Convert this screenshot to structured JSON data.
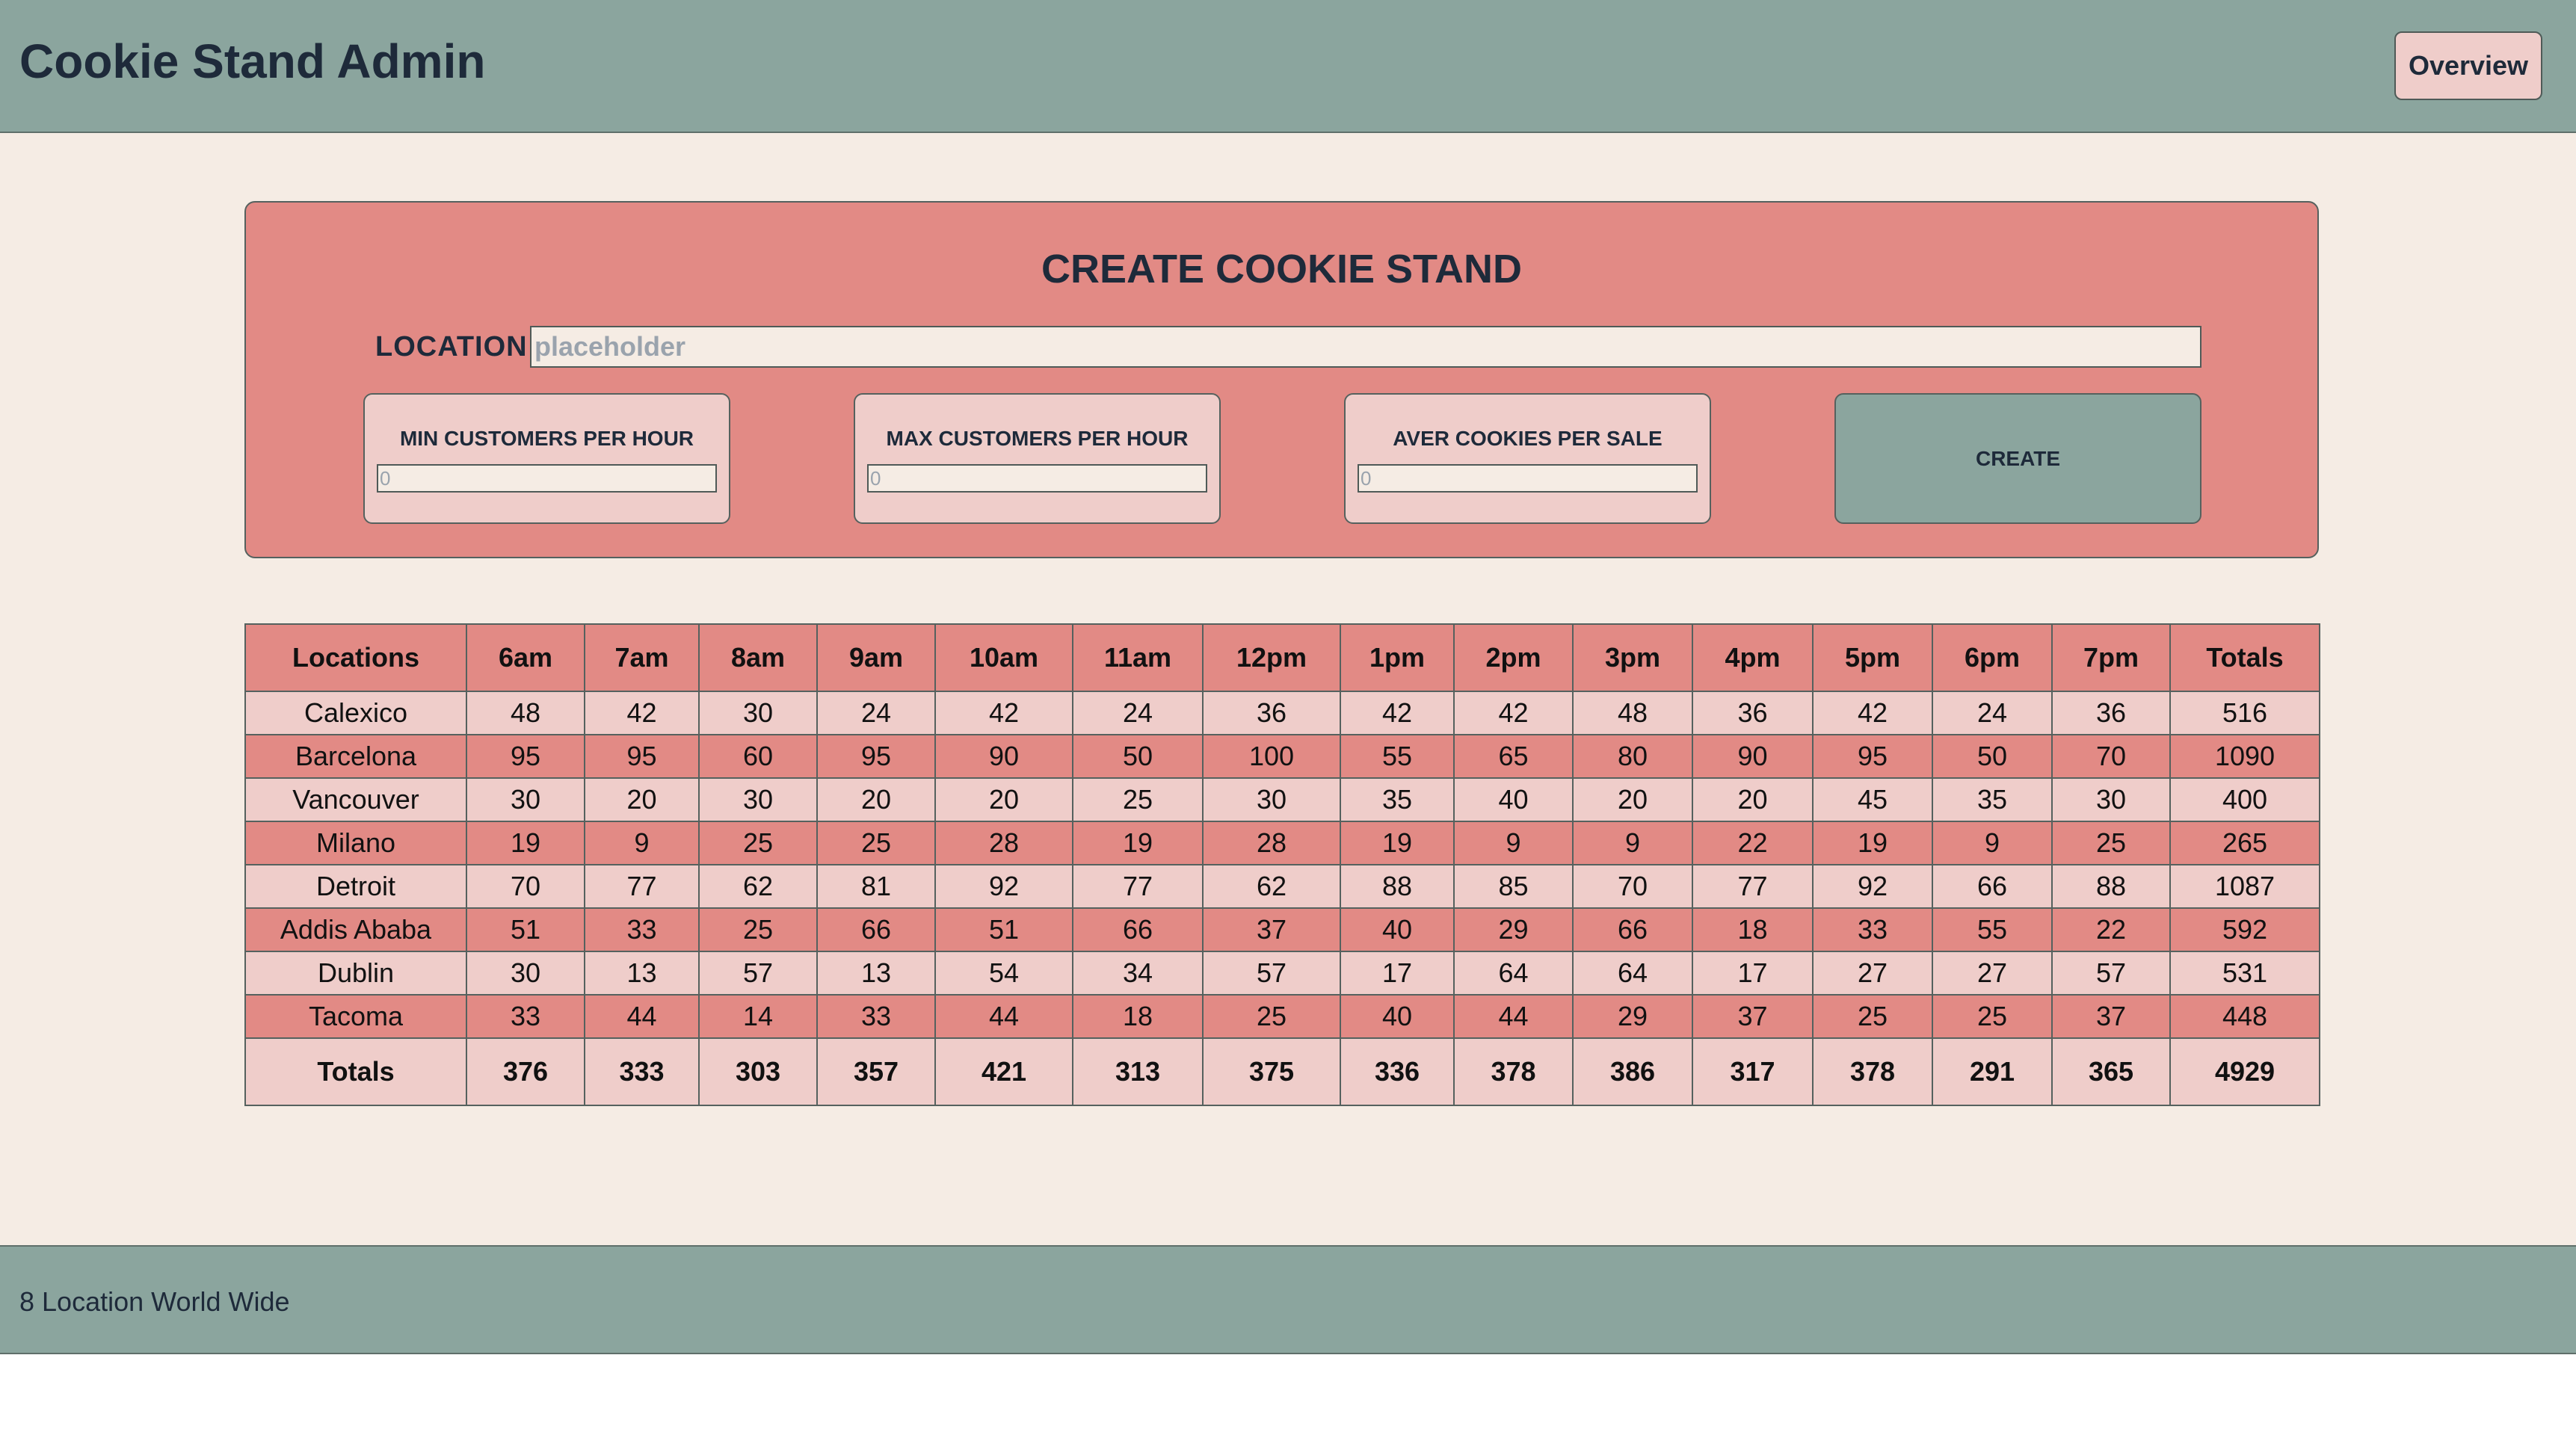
{
  "header": {
    "title": "Cookie Stand Admin",
    "overview_label": "Overview"
  },
  "form": {
    "title": "CREATE COOKIE STAND",
    "location_label": "LOCATION",
    "location_placeholder": "placeholder",
    "min_label": "MIN CUSTOMERS PER HOUR",
    "min_placeholder": "0",
    "max_label": "MAX CUSTOMERS PER HOUR",
    "max_placeholder": "0",
    "avg_label": "AVER COOKIES PER SALE",
    "avg_placeholder": "0",
    "create_label": "CREATE"
  },
  "table": {
    "headers": [
      "Locations",
      "6am",
      "7am",
      "8am",
      "9am",
      "10am",
      "11am",
      "12pm",
      "1pm",
      "2pm",
      "3pm",
      "4pm",
      "5pm",
      "6pm",
      "7pm",
      "Totals"
    ],
    "rows": [
      [
        "Calexico",
        "48",
        "42",
        "30",
        "24",
        "42",
        "24",
        "36",
        "42",
        "42",
        "48",
        "36",
        "42",
        "24",
        "36",
        "516"
      ],
      [
        "Barcelona",
        "95",
        "95",
        "60",
        "95",
        "90",
        "50",
        "100",
        "55",
        "65",
        "80",
        "90",
        "95",
        "50",
        "70",
        "1090"
      ],
      [
        "Vancouver",
        "30",
        "20",
        "30",
        "20",
        "20",
        "25",
        "30",
        "35",
        "40",
        "20",
        "20",
        "45",
        "35",
        "30",
        "400"
      ],
      [
        "Milano",
        "19",
        "9",
        "25",
        "25",
        "28",
        "19",
        "28",
        "19",
        "9",
        "9",
        "22",
        "19",
        "9",
        "25",
        "265"
      ],
      [
        "Detroit",
        "70",
        "77",
        "62",
        "81",
        "92",
        "77",
        "62",
        "88",
        "85",
        "70",
        "77",
        "92",
        "66",
        "88",
        "1087"
      ],
      [
        "Addis Ababa",
        "51",
        "33",
        "25",
        "66",
        "51",
        "66",
        "37",
        "40",
        "29",
        "66",
        "18",
        "33",
        "55",
        "22",
        "592"
      ],
      [
        "Dublin",
        "30",
        "13",
        "57",
        "13",
        "54",
        "34",
        "57",
        "17",
        "64",
        "64",
        "17",
        "27",
        "27",
        "57",
        "531"
      ],
      [
        "Tacoma",
        "33",
        "44",
        "14",
        "33",
        "44",
        "18",
        "25",
        "40",
        "44",
        "29",
        "37",
        "25",
        "25",
        "37",
        "448"
      ]
    ],
    "totals": [
      "Totals",
      "376",
      "333",
      "303",
      "357",
      "421",
      "313",
      "375",
      "336",
      "378",
      "386",
      "317",
      "378",
      "291",
      "365",
      "4929"
    ]
  },
  "footer": {
    "text": "8 Location World Wide"
  },
  "colors": {
    "header_bg": "#8ba59e",
    "main_bg": "#f5ece4",
    "panel_bg": "#e28a85",
    "light_row": "#efcdca",
    "dark_row": "#e28a85"
  }
}
